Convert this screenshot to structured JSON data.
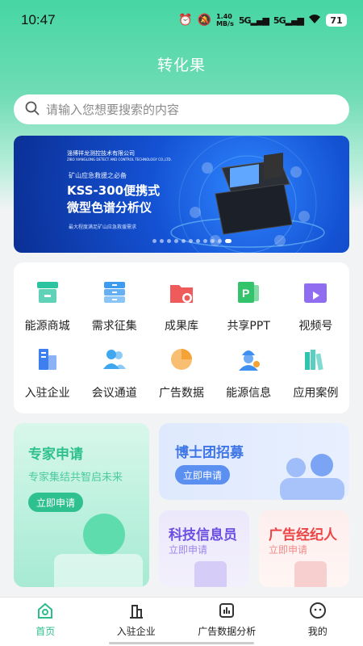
{
  "status_bar": {
    "time": "10:47",
    "net_speed_value": "1.40",
    "net_speed_unit": "MB/s",
    "signal1": "5G",
    "signal2": "5G",
    "battery": "71"
  },
  "header": {
    "title": "转化果"
  },
  "search": {
    "placeholder": "请输入您想要搜索的内容"
  },
  "banner": {
    "company_cn": "淄博祥龙测控技术有限公司",
    "company_en": "ZIBO XIANGLONG DETECT AND CONTROL TECHNOLOGY CO.,LTD.",
    "tag": "矿山应急救援之必备",
    "headline1": "KSS-300便携式",
    "headline2": "微型色谱分析仪",
    "subline": "最大程度满足矿山应急救援需求",
    "slide_count": 11,
    "active_slide": 11
  },
  "grid": {
    "row1": [
      {
        "label": "能源商城",
        "icon": "store-icon",
        "color": "#2bc3a0"
      },
      {
        "label": "需求征集",
        "icon": "drawers-icon",
        "color": "#3e9cf0"
      },
      {
        "label": "成果库",
        "icon": "folder-star-icon",
        "color": "#ef5a5a"
      },
      {
        "label": "共享PPT",
        "icon": "ppt-icon",
        "color": "#33c36b"
      },
      {
        "label": "视频号",
        "icon": "video-icon",
        "color": "#8f6cf0"
      }
    ],
    "row2": [
      {
        "label": "入驻企业",
        "icon": "building-icon",
        "color": "#3e7ff0"
      },
      {
        "label": "会议通道",
        "icon": "users-icon",
        "color": "#3fa7f0"
      },
      {
        "label": "广告数据",
        "icon": "pie-chart-icon",
        "color": "#f5a236"
      },
      {
        "label": "能源信息",
        "icon": "worker-icon",
        "color": "#3e8ff0"
      },
      {
        "label": "应用案例",
        "icon": "books-icon",
        "color": "#2fc3b0"
      }
    ]
  },
  "cards": {
    "expert": {
      "title": "专家申请",
      "subtitle": "专家集结共智启未来",
      "button": "立即申请"
    },
    "doctor": {
      "title": "博士团招募",
      "button": "立即申请"
    },
    "tech": {
      "title": "科技信息员",
      "subtitle": "立即申请"
    },
    "ad": {
      "title": "广告经纪人",
      "subtitle": "立即申请"
    }
  },
  "bottom_nav": [
    {
      "label": "首页",
      "icon": "home-icon",
      "active": true
    },
    {
      "label": "入驻企业",
      "icon": "building-columns-icon",
      "active": false
    },
    {
      "label": "广告数据分析",
      "icon": "bar-chart-icon",
      "active": false
    },
    {
      "label": "我的",
      "icon": "profile-icon",
      "active": false
    }
  ],
  "colors": {
    "accent": "#2bbd8c",
    "header_green": "#46d6a4",
    "expert_green": "#2ec08e",
    "doctor_blue": "#3f76e6",
    "tech_purple": "#6b4fe0",
    "ad_red": "#ec4545"
  }
}
